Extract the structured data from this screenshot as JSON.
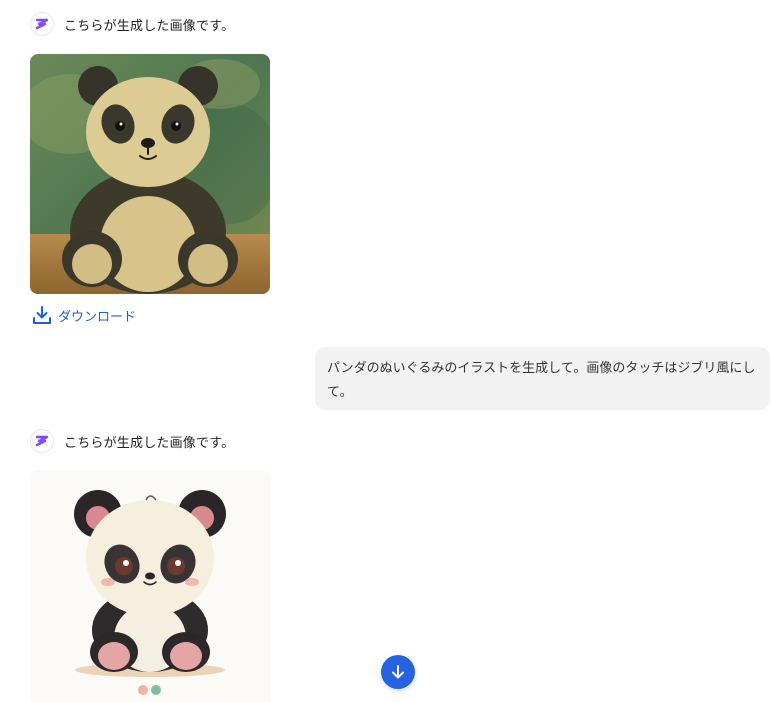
{
  "messages": [
    {
      "role": "assistant",
      "text": "こちらが生成した画像です。",
      "image": "plush-panda-painting"
    },
    {
      "role": "user",
      "text": "パンダのぬいぐるみのイラストを生成して。画像のタッチはジブリ風にして。"
    },
    {
      "role": "assistant",
      "text": "こちらが生成した画像です。",
      "image": "chibi-panda-illustration"
    }
  ],
  "actions": {
    "download_label": "ダウンロード"
  },
  "icons": {
    "avatar": "s-logo-icon",
    "download": "download-icon",
    "scroll": "arrow-down-icon"
  },
  "colors": {
    "accent": "#2563e0",
    "link": "#1f5fd6",
    "user_bubble": "#f2f2f2"
  }
}
